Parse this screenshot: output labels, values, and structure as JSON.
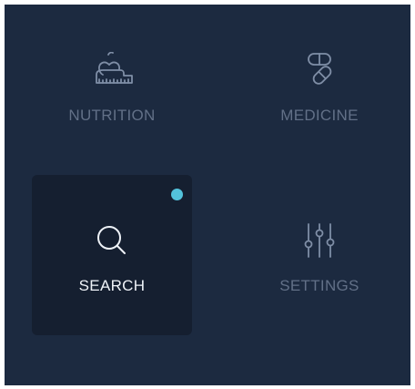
{
  "menu": {
    "tiles": [
      {
        "label": "NUTRITION",
        "icon": "apple-scale-icon",
        "active": false
      },
      {
        "label": "MEDICINE",
        "icon": "pills-icon",
        "active": false
      },
      {
        "label": "SEARCH",
        "icon": "search-icon",
        "active": true,
        "notification": true
      },
      {
        "label": "SETTINGS",
        "icon": "sliders-icon",
        "active": false
      }
    ]
  },
  "colors": {
    "background": "#1c2a40",
    "active_tile": "#151f30",
    "icon_inactive": "#7f8ea6",
    "icon_active": "#eef2f7",
    "label_inactive": "#627087",
    "label_active": "#eef2f7",
    "notification_dot": "#53c3dc"
  }
}
